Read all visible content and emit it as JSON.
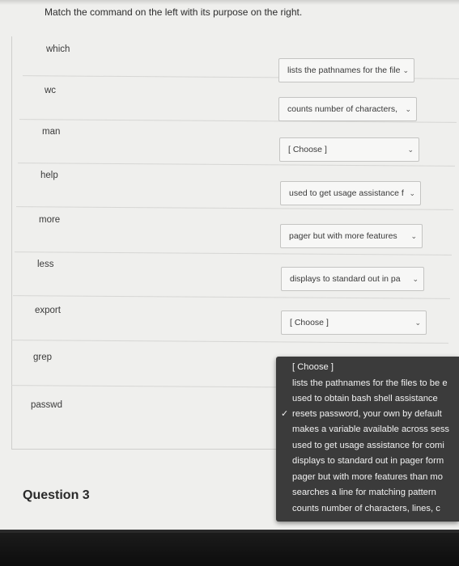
{
  "instruction": "Match the command on the left with its purpose on the right.",
  "rows": [
    {
      "command": "which",
      "selected": "lists the pathnames for the file"
    },
    {
      "command": "wc",
      "selected": "counts number of characters,"
    },
    {
      "command": "man",
      "selected": "[ Choose ]"
    },
    {
      "command": "help",
      "selected": "used to get usage assistance f"
    },
    {
      "command": "more",
      "selected": "pager but with more features"
    },
    {
      "command": "less",
      "selected": "displays to standard out in pa"
    },
    {
      "command": "export",
      "selected": "[ Choose ]"
    },
    {
      "command": "grep",
      "selected": ""
    },
    {
      "command": "passwd",
      "selected": ""
    }
  ],
  "dropdown": {
    "options": [
      {
        "label": "[ Choose ]",
        "checked": false
      },
      {
        "label": "lists the pathnames for the files to be e",
        "checked": false
      },
      {
        "label": "used to obtain bash shell assistance",
        "checked": false
      },
      {
        "label": "resets password, your own by default",
        "checked": true
      },
      {
        "label": "makes a variable available across sess",
        "checked": false
      },
      {
        "label": "used to get usage assistance for comi",
        "checked": false
      },
      {
        "label": "displays to standard out in pager form",
        "checked": false
      },
      {
        "label": "pager but with more features than mo",
        "checked": false
      },
      {
        "label": "searches a line for matching pattern",
        "checked": false
      },
      {
        "label": "counts number of characters, lines, c",
        "checked": false
      }
    ],
    "check_icon": "checkmark-icon"
  },
  "question_title": "Question 3",
  "icons": {
    "chevron": "chevron-down-icon"
  }
}
